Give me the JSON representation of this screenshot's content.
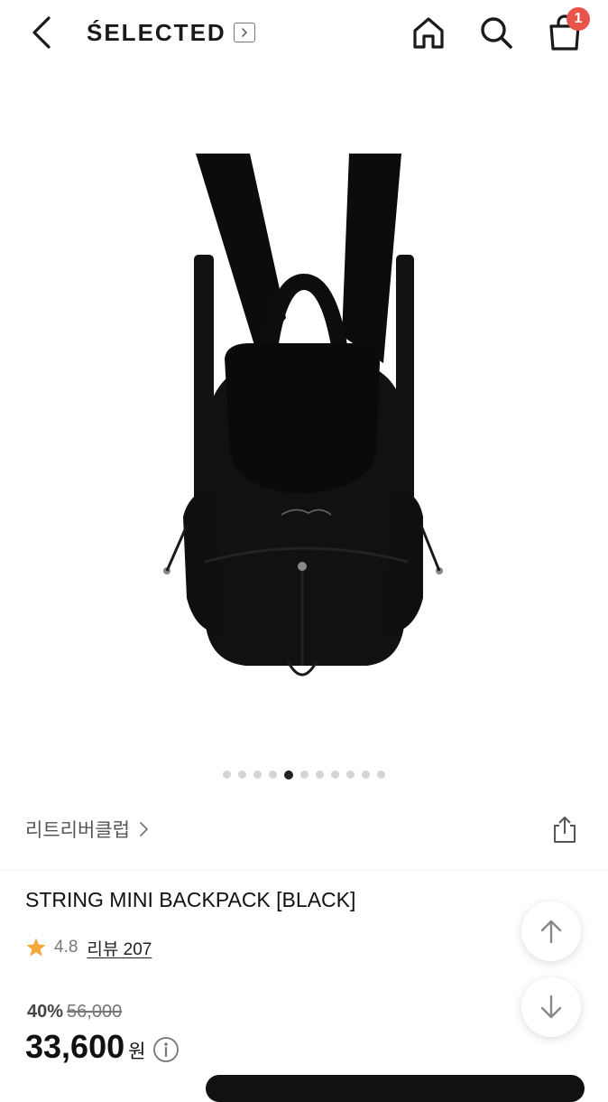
{
  "header": {
    "brand": "ŚELECTED",
    "cart_count": "1"
  },
  "icons": {
    "back": "chevron-left-icon",
    "brand_link": "chevron-right-box-icon",
    "home": "home-icon",
    "search": "search-icon",
    "cart": "shopping-bag-icon",
    "share": "share-icon",
    "info": "info-circle-icon",
    "star": "star-icon",
    "scroll_up": "arrow-up-icon",
    "scroll_down": "arrow-down-icon"
  },
  "carousel": {
    "total": 11,
    "active_index": 4
  },
  "product": {
    "brand_name": "리트리버클럽",
    "title": "STRING MINI BACKPACK [BLACK]",
    "rating": "4.8",
    "reviews": "리뷰 207",
    "discount": "40%",
    "original_price": "56,000",
    "price": "33,600",
    "currency": "원"
  },
  "colors": {
    "badge": "#e8534a",
    "star": "#f2a83b",
    "text": "#111111"
  }
}
